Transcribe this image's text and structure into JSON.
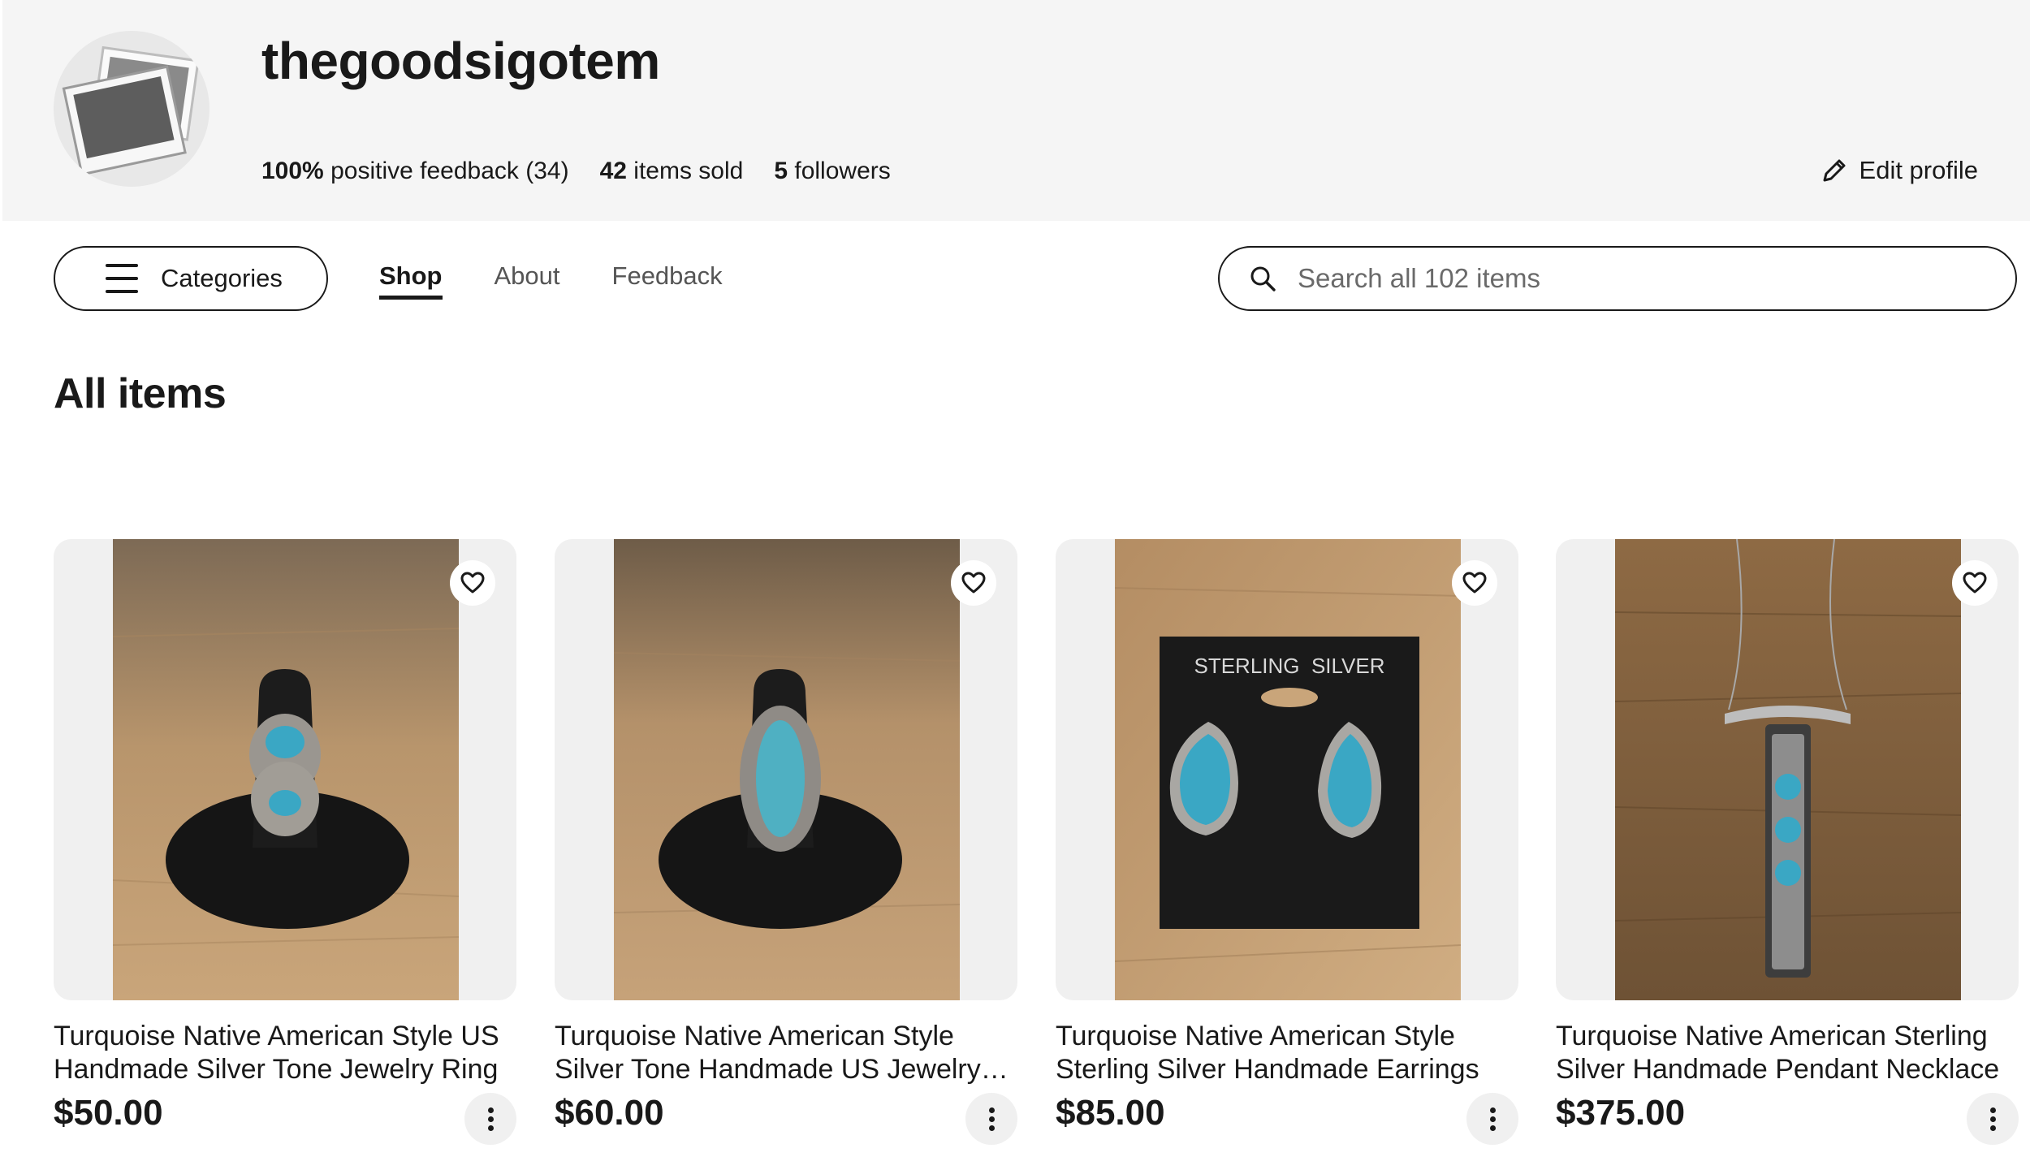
{
  "store": {
    "name": "thegoodsigotem",
    "feedback_percent": "100%",
    "feedback_text": "positive feedback (34)",
    "items_sold_count": "42",
    "items_sold_text": "items sold",
    "followers_count": "5",
    "followers_text": "followers",
    "edit_profile_label": "Edit profile",
    "avatar_icon": "photo-placeholder-icon"
  },
  "nav": {
    "categories_label": "Categories",
    "tabs": [
      {
        "label": "Shop",
        "active": true
      },
      {
        "label": "About",
        "active": false
      },
      {
        "label": "Feedback",
        "active": false
      }
    ],
    "search_placeholder": "Search all 102 items"
  },
  "section_title": "All items",
  "items": [
    {
      "title": "Turquoise Native American Style US Handmade Silver Tone Jewelry Ring",
      "price": "$50.00"
    },
    {
      "title": "Turquoise Native American Style Silver Tone Handmade US Jewelry…",
      "price": "$60.00"
    },
    {
      "title": "Turquoise Native American Style Sterling Silver Handmade Earrings",
      "price": "$85.00"
    },
    {
      "title": "Turquoise Native American Sterling Silver Handmade Pendant Necklace",
      "price": "$375.00"
    }
  ],
  "earring_card_text": "STERLING  SILVER",
  "colors": {
    "header_bg": "#f5f5f5",
    "text": "#191919",
    "turquoise": "#3aa7c4",
    "wood": "#b58a5a"
  }
}
